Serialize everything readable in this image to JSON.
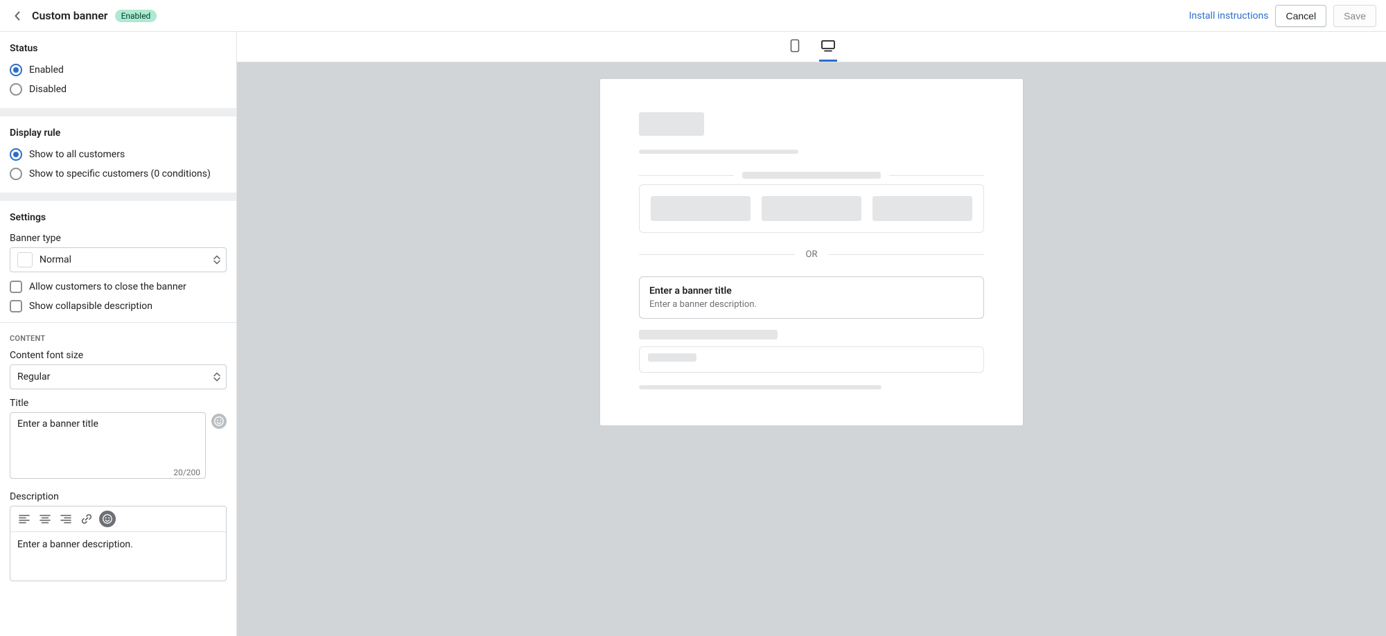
{
  "header": {
    "title": "Custom banner",
    "badge": "Enabled",
    "install_link": "Install instructions",
    "cancel": "Cancel",
    "save": "Save"
  },
  "sidebar": {
    "status": {
      "heading": "Status",
      "enabled": "Enabled",
      "disabled": "Disabled",
      "selected": "enabled"
    },
    "display_rule": {
      "heading": "Display rule",
      "all": "Show to all customers",
      "specific": "Show to specific customers (0 conditions)",
      "selected": "all"
    },
    "settings": {
      "heading": "Settings",
      "banner_type_label": "Banner type",
      "banner_type_value": "Normal",
      "allow_close": "Allow customers to close the banner",
      "collapsible": "Show collapsible description"
    },
    "content": {
      "section": "CONTENT",
      "font_size_label": "Content font size",
      "font_size_value": "Regular",
      "title_label": "Title",
      "title_value": "Enter a banner title",
      "title_counter": "20/200",
      "description_label": "Description",
      "description_value": "Enter a banner description."
    }
  },
  "preview": {
    "or": "OR",
    "banner_title": "Enter a banner title",
    "banner_desc": "Enter a banner description."
  }
}
